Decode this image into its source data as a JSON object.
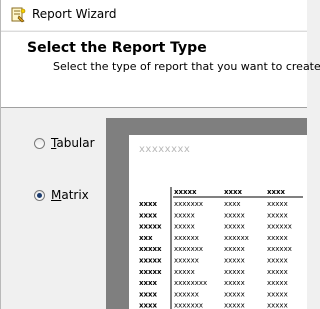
{
  "window": {
    "title": "Report Wizard",
    "icon": "report-wizard-icon"
  },
  "header": {
    "title": "Select the Report Type",
    "subtitle": "Select the type of report that you want to create."
  },
  "options": {
    "tabular": {
      "label_prefix": "",
      "mnemonic": "T",
      "label_rest": "abular",
      "checked": false
    },
    "matrix": {
      "label_prefix": "",
      "mnemonic": "M",
      "label_rest": "atrix",
      "checked": true
    }
  },
  "preview": {
    "title": "xxxxxxxx",
    "column_headers": [
      "xxxxx",
      "xxxx",
      "xxxx"
    ],
    "row_headers": [
      "xxxx",
      "xxxx",
      "xxxxx",
      "xxx",
      "xxxxx",
      "xxxxx",
      "xxxxx",
      "xxxx",
      "xxxx",
      "xxxx"
    ],
    "cells": [
      [
        "xxxxxxx",
        "xxxx",
        "xxxxx"
      ],
      [
        "xxxxx",
        "xxxxx",
        "xxxxx"
      ],
      [
        "xxxxx",
        "xxxxx",
        "xxxxxx"
      ],
      [
        "xxxxxx",
        "xxxxxx",
        "xxxxx"
      ],
      [
        "xxxxxxx",
        "xxxxx",
        "xxxxxx"
      ],
      [
        "xxxxxx",
        "xxxxx",
        "xxxxx"
      ],
      [
        "xxxxx",
        "xxxxx",
        "xxxxx"
      ],
      [
        "xxxxxxxx",
        "xxxxx",
        "xxxxx"
      ],
      [
        "xxxxxx",
        "xxxxx",
        "xxxxx"
      ],
      [
        "xxxxxxx",
        "xxxxx",
        "xxxxx"
      ]
    ]
  }
}
